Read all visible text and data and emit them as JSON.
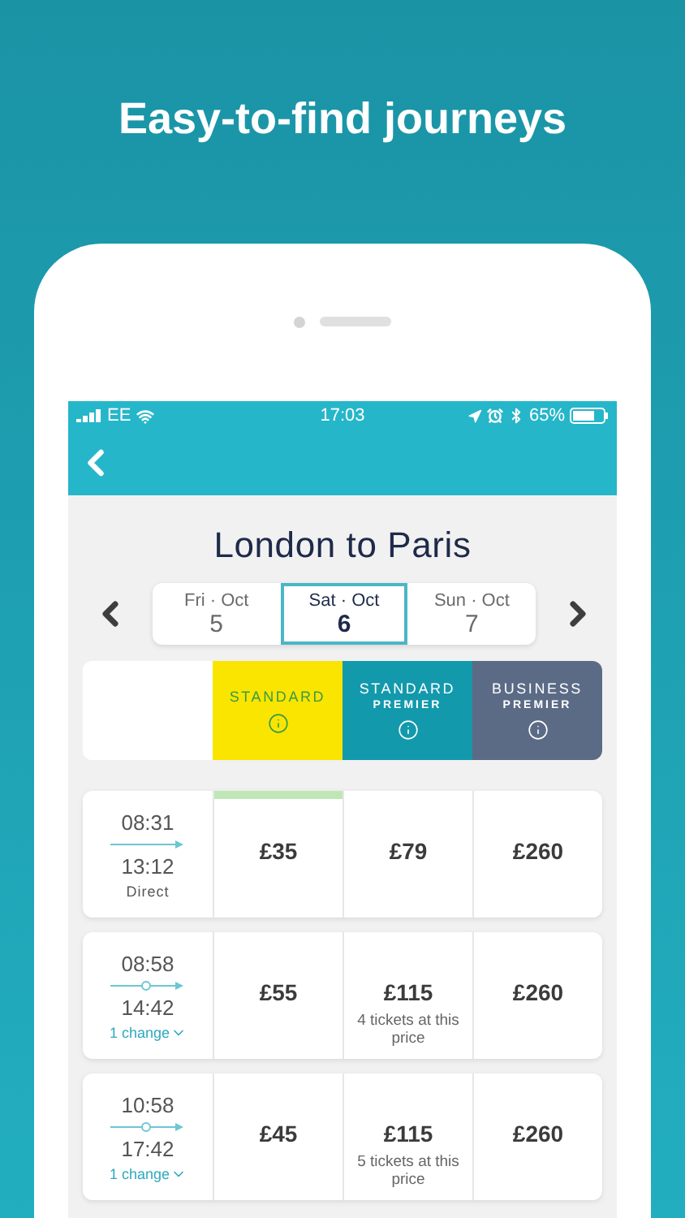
{
  "headline": "Easy-to-find journeys",
  "status_bar": {
    "carrier": "EE",
    "time": "17:03",
    "battery": "65%"
  },
  "title": "London to Paris",
  "dates": [
    {
      "label": "Fri · Oct",
      "date": "5",
      "selected": false
    },
    {
      "label": "Sat · Oct",
      "date": "6",
      "selected": true
    },
    {
      "label": "Sun · Oct",
      "date": "7",
      "selected": false
    }
  ],
  "classes": [
    {
      "name": "STANDARD",
      "color": "#f9e500"
    },
    {
      "name": "STANDARD",
      "sub": "PREMIER",
      "color": "#1399ac"
    },
    {
      "name": "BUSINESS",
      "sub": "PREMIER",
      "color": "#5b6b86"
    }
  ],
  "journeys": [
    {
      "depart": "08:31",
      "arrive": "13:12",
      "kind": "direct",
      "changes": "Direct",
      "fares": [
        {
          "price": "£35",
          "highlighted": true
        },
        {
          "price": "£79",
          "highlighted": false
        },
        {
          "price": "£260",
          "highlighted": false
        }
      ]
    },
    {
      "depart": "08:58",
      "arrive": "14:42",
      "kind": "change",
      "changes": "1 change",
      "fares": [
        {
          "price": "£55",
          "highlighted": false
        },
        {
          "price": "£115",
          "note": "4 tickets at this price",
          "highlighted": false
        },
        {
          "price": "£260",
          "highlighted": false
        }
      ]
    },
    {
      "depart": "10:58",
      "arrive": "17:42",
      "kind": "change",
      "changes": "1 change",
      "fares": [
        {
          "price": "£45",
          "highlighted": false
        },
        {
          "price": "£115",
          "note": "5 tickets at this price",
          "highlighted": false
        },
        {
          "price": "£260",
          "highlighted": false
        }
      ]
    }
  ]
}
